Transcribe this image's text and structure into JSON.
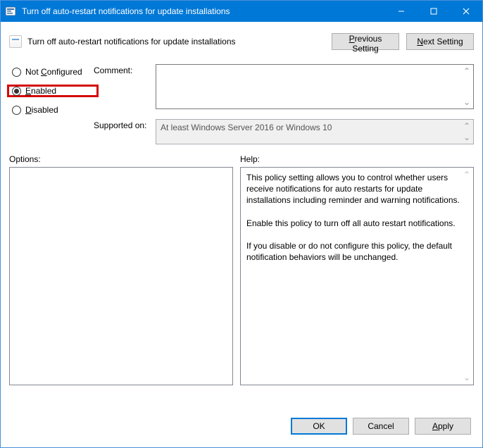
{
  "window": {
    "title": "Turn off auto-restart notifications for update installations"
  },
  "header": {
    "title": "Turn off auto-restart notifications for update installations",
    "prev_label": "Previous Setting",
    "next_label": "Next Setting"
  },
  "radios": {
    "not_configured": "Not Configured",
    "enabled": "Enabled",
    "disabled": "Disabled",
    "selected": "enabled"
  },
  "fields": {
    "comment_label": "Comment:",
    "comment_value": "",
    "supported_label": "Supported on:",
    "supported_value": "At least Windows Server 2016 or Windows 10"
  },
  "panes": {
    "options_label": "Options:",
    "help_label": "Help:",
    "help_p1": "This policy setting allows you to control whether users receive notifications for auto restarts for update installations including reminder and warning notifications.",
    "help_p2": "Enable this policy to turn off all auto restart notifications.",
    "help_p3": "If you disable or do not configure this policy, the default notification behaviors will be unchanged."
  },
  "footer": {
    "ok": "OK",
    "cancel": "Cancel",
    "apply": "Apply"
  }
}
